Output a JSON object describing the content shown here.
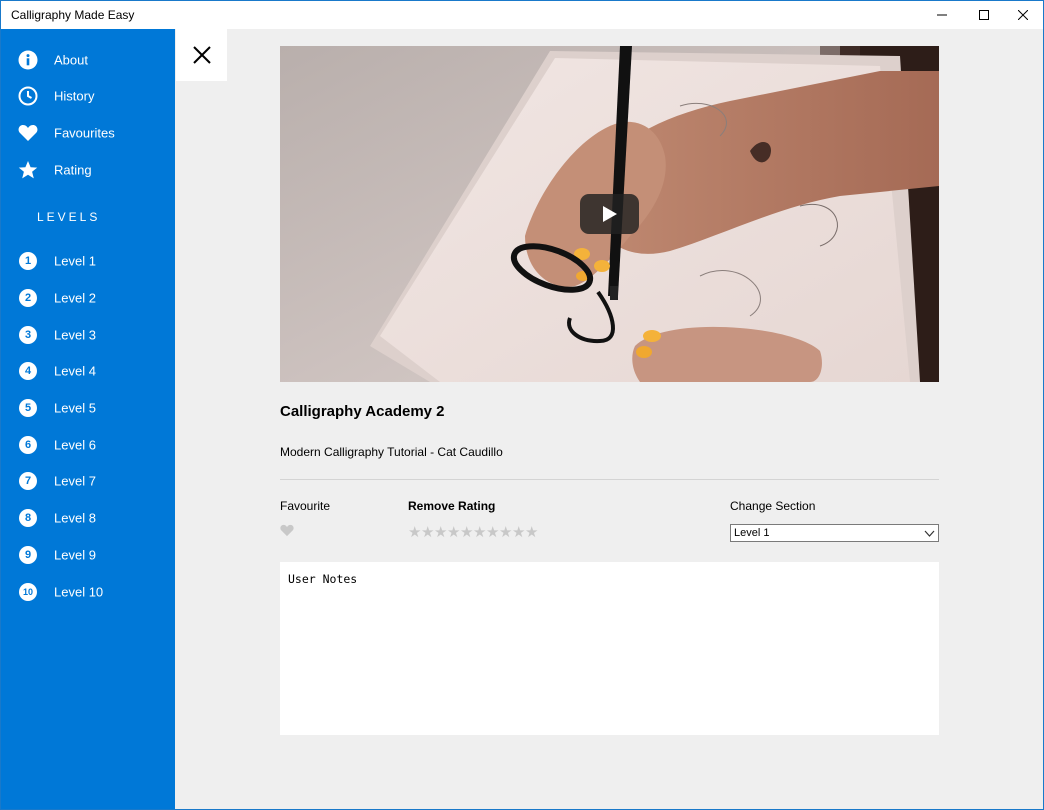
{
  "window": {
    "title": "Calligraphy Made Easy"
  },
  "sidebar": {
    "bg_color": "#0078d7",
    "menu": [
      {
        "label": "About",
        "icon": "info-icon"
      },
      {
        "label": "History",
        "icon": "clock-icon"
      },
      {
        "label": "Favourites",
        "icon": "heart-icon"
      },
      {
        "label": "Rating",
        "icon": "star-icon"
      }
    ],
    "levels_heading": "LEVELS",
    "levels": [
      {
        "num": "1",
        "label": "Level 1"
      },
      {
        "num": "2",
        "label": "Level 2"
      },
      {
        "num": "3",
        "label": "Level 3"
      },
      {
        "num": "4",
        "label": "Level 4"
      },
      {
        "num": "5",
        "label": "Level 5"
      },
      {
        "num": "6",
        "label": "Level 6"
      },
      {
        "num": "7",
        "label": "Level 7"
      },
      {
        "num": "8",
        "label": "Level 8"
      },
      {
        "num": "9",
        "label": "Level 9"
      },
      {
        "num": "10",
        "label": "Level 10"
      }
    ]
  },
  "main": {
    "video_title": "Calligraphy Academy 2",
    "video_subtitle": "Modern Calligraphy Tutorial - Cat Caudillo",
    "favourite_label": "Favourite",
    "rating_label": "Remove Rating",
    "rating_stars": 10,
    "rating_value": 0,
    "change_section_label": "Change Section",
    "section_selected": "Level 1",
    "notes_placeholder": "User Notes"
  }
}
